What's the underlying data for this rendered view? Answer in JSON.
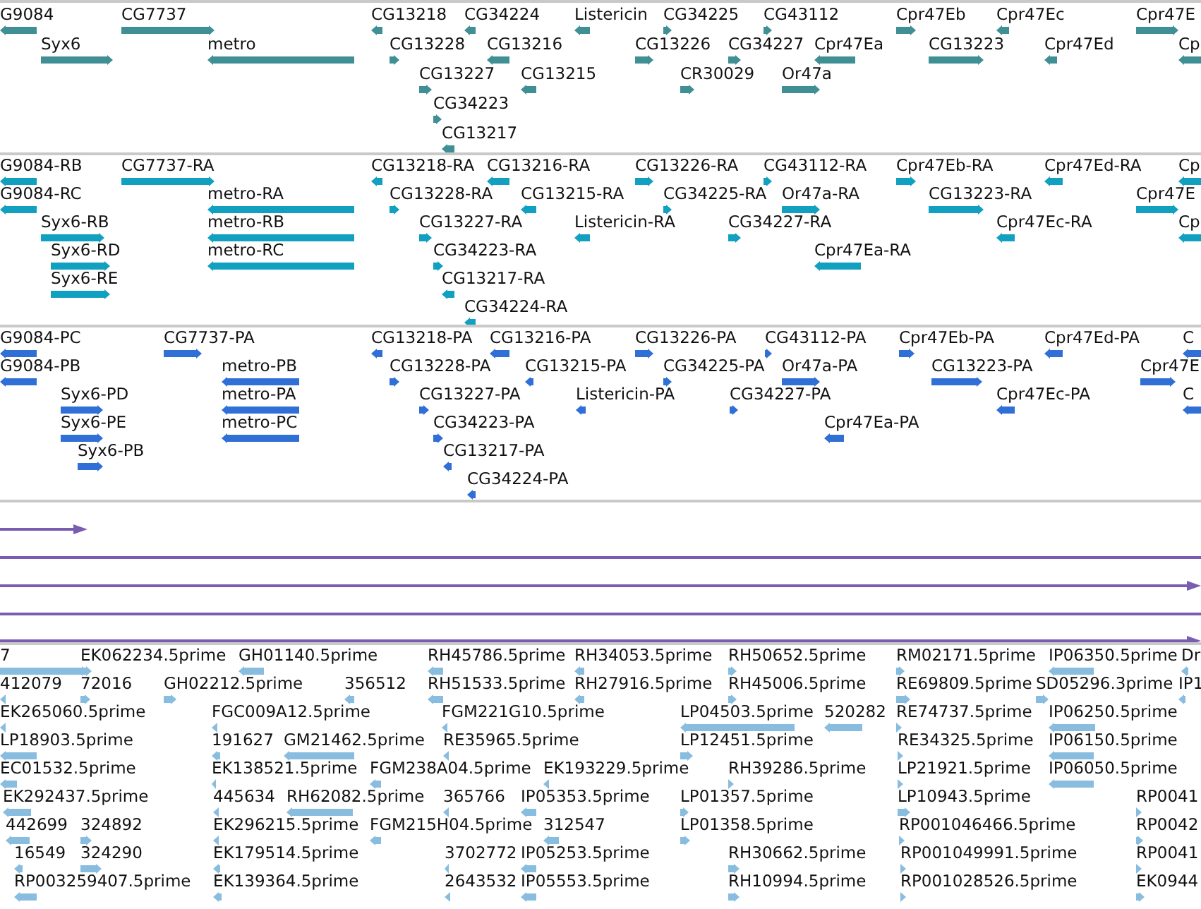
{
  "tracks": [
    {
      "kind": "genes",
      "features": [
        {
          "label": "G9084",
          "reverse": true
        },
        {
          "label": "CG7737",
          "reverse": false
        },
        {
          "label": "CG13218",
          "reverse": true
        },
        {
          "label": "CG34224",
          "reverse": true
        },
        {
          "label": "Listericin",
          "reverse": true
        },
        {
          "label": "CG34225",
          "reverse": false
        },
        {
          "label": "CG43112",
          "reverse": false
        },
        {
          "label": "Cpr47Eb",
          "reverse": false
        },
        {
          "label": "Cpr47Ec",
          "reverse": true
        },
        {
          "label": "Cpr47E",
          "reverse": false
        },
        {
          "label": "Syx6",
          "reverse": false
        },
        {
          "label": "metro",
          "reverse": true
        },
        {
          "label": "CG13228",
          "reverse": false
        },
        {
          "label": "CG13216",
          "reverse": true
        },
        {
          "label": "CG13226",
          "reverse": false
        },
        {
          "label": "CG34227",
          "reverse": false
        },
        {
          "label": "Cpr47Ea",
          "reverse": true
        },
        {
          "label": "CG13223",
          "reverse": false
        },
        {
          "label": "Cpr47Ed",
          "reverse": true
        },
        {
          "label": "Cp",
          "reverse": true
        },
        {
          "label": "CG13227",
          "reverse": false
        },
        {
          "label": "CG13215",
          "reverse": true
        },
        {
          "label": "CR30029",
          "reverse": false
        },
        {
          "label": "Or47a",
          "reverse": false
        },
        {
          "label": "CG34223",
          "reverse": false
        },
        {
          "label": "CG13217",
          "reverse": true
        }
      ]
    },
    {
      "kind": "transcripts",
      "features": [
        {
          "label": "G9084-RB",
          "reverse": true
        },
        {
          "label": "CG7737-RA",
          "reverse": false
        },
        {
          "label": "CG13218-RA",
          "reverse": true
        },
        {
          "label": "CG13216-RA",
          "reverse": true
        },
        {
          "label": "CG13226-RA",
          "reverse": false
        },
        {
          "label": "CG43112-RA",
          "reverse": false
        },
        {
          "label": "Cpr47Eb-RA",
          "reverse": false
        },
        {
          "label": "Cpr47Ed-RA",
          "reverse": true
        },
        {
          "label": "Cp",
          "reverse": true
        },
        {
          "label": "G9084-RC",
          "reverse": true
        },
        {
          "label": "metro-RA",
          "reverse": true
        },
        {
          "label": "CG13228-RA",
          "reverse": false
        },
        {
          "label": "CG13215-RA",
          "reverse": true
        },
        {
          "label": "CG34225-RA",
          "reverse": false
        },
        {
          "label": "Or47a-RA",
          "reverse": false
        },
        {
          "label": "CG13223-RA",
          "reverse": false
        },
        {
          "label": "Cpr47E",
          "reverse": false
        },
        {
          "label": "Syx6-RB",
          "reverse": false
        },
        {
          "label": "metro-RB",
          "reverse": true
        },
        {
          "label": "CG13227-RA",
          "reverse": false
        },
        {
          "label": "Listericin-RA",
          "reverse": true
        },
        {
          "label": "CG34227-RA",
          "reverse": false
        },
        {
          "label": "Cpr47Ec-RA",
          "reverse": true
        },
        {
          "label": "Cp",
          "reverse": true
        },
        {
          "label": "Syx6-RD",
          "reverse": false
        },
        {
          "label": "metro-RC",
          "reverse": true
        },
        {
          "label": "CG34223-RA",
          "reverse": false
        },
        {
          "label": "Cpr47Ea-RA",
          "reverse": true
        },
        {
          "label": "Syx6-RE",
          "reverse": false
        },
        {
          "label": "CG13217-RA",
          "reverse": true
        },
        {
          "label": "CG34224-RA",
          "reverse": true
        }
      ]
    },
    {
      "kind": "proteins",
      "features": [
        {
          "label": "G9084-PC",
          "reverse": true
        },
        {
          "label": "CG7737-PA",
          "reverse": false
        },
        {
          "label": "CG13218-PA",
          "reverse": true
        },
        {
          "label": "CG13216-PA",
          "reverse": true
        },
        {
          "label": "CG13226-PA",
          "reverse": false
        },
        {
          "label": "CG43112-PA",
          "reverse": false
        },
        {
          "label": "Cpr47Eb-PA",
          "reverse": false
        },
        {
          "label": "Cpr47Ed-PA",
          "reverse": true
        },
        {
          "label": "C",
          "reverse": true
        },
        {
          "label": "G9084-PB",
          "reverse": true
        },
        {
          "label": "metro-PB",
          "reverse": true
        },
        {
          "label": "CG13228-PA",
          "reverse": false
        },
        {
          "label": "CG13215-PA",
          "reverse": true
        },
        {
          "label": "CG34225-PA",
          "reverse": false
        },
        {
          "label": "Or47a-PA",
          "reverse": false
        },
        {
          "label": "CG13223-PA",
          "reverse": false
        },
        {
          "label": "Cpr47E",
          "reverse": false
        },
        {
          "label": "Syx6-PD",
          "reverse": false
        },
        {
          "label": "metro-PA",
          "reverse": true
        },
        {
          "label": "CG13227-PA",
          "reverse": false
        },
        {
          "label": "Listericin-PA",
          "reverse": true
        },
        {
          "label": "CG34227-PA",
          "reverse": false
        },
        {
          "label": "Cpr47Ec-PA",
          "reverse": true
        },
        {
          "label": "C",
          "reverse": true
        },
        {
          "label": "Syx6-PE",
          "reverse": false
        },
        {
          "label": "metro-PC",
          "reverse": true
        },
        {
          "label": "CG34223-PA",
          "reverse": false
        },
        {
          "label": "Cpr47Ea-PA",
          "reverse": true
        },
        {
          "label": "Syx6-PB",
          "reverse": false
        },
        {
          "label": "CG13217-PA",
          "reverse": true
        },
        {
          "label": "CG34224-PA",
          "reverse": true
        }
      ]
    },
    {
      "kind": "alignments",
      "alignments": [
        {
          "kind": "line",
          "arrow": true
        },
        {
          "kind": "line"
        },
        {
          "kind": "line",
          "arrow": true
        },
        {
          "kind": "line"
        },
        {
          "kind": "line",
          "arrow": true
        }
      ]
    },
    {
      "kind": "ests",
      "features": [
        {
          "label": "7",
          "reverse": false
        },
        {
          "label": "EK062234.5prime",
          "reverse": false
        },
        {
          "label": "GH01140.5prime",
          "reverse": true
        },
        {
          "label": "RH45786.5prime",
          "reverse": true
        },
        {
          "label": "RH34053.5prime",
          "reverse": true
        },
        {
          "label": "RH50652.5prime",
          "reverse": false
        },
        {
          "label": "RM02171.5prime",
          "reverse": false
        },
        {
          "label": "IP06350.5prime",
          "reverse": true
        },
        {
          "label": "Dr",
          "reverse": true
        },
        {
          "label": "412079",
          "reverse": true
        },
        {
          "label": "72016",
          "reverse": false
        },
        {
          "label": "GH02212.5prime",
          "reverse": false
        },
        {
          "label": "356512",
          "reverse": true
        },
        {
          "label": "RH51533.5prime",
          "reverse": true
        },
        {
          "label": "RH27916.5prime",
          "reverse": true
        },
        {
          "label": "RH45006.5prime",
          "reverse": false
        },
        {
          "label": "RE69809.5prime",
          "reverse": false
        },
        {
          "label": "SD05296.3prime",
          "reverse": false
        },
        {
          "label": "IP1",
          "reverse": true
        },
        {
          "label": "EK265060.5prime",
          "reverse": true
        },
        {
          "label": "FGC009A12.5prime",
          "reverse": true
        },
        {
          "label": "FGM221G10.5prime",
          "reverse": true
        },
        {
          "label": "LP04503.5prime",
          "reverse": true
        },
        {
          "label": "520282",
          "reverse": true
        },
        {
          "label": "RE74737.5prime",
          "reverse": false
        },
        {
          "label": "IP06250.5prime",
          "reverse": true
        },
        {
          "label": "LP18903.5prime",
          "reverse": true
        },
        {
          "label": "191627",
          "reverse": true
        },
        {
          "label": "GM21462.5prime",
          "reverse": true
        },
        {
          "label": "RE35965.5prime",
          "reverse": true
        },
        {
          "label": "LP12451.5prime",
          "reverse": false
        },
        {
          "label": "RE34325.5prime",
          "reverse": false
        },
        {
          "label": "IP06150.5prime",
          "reverse": true
        },
        {
          "label": "EC01532.5prime",
          "reverse": true
        },
        {
          "label": "EK138521.5prime",
          "reverse": true
        },
        {
          "label": "FGM238A04.5prime",
          "reverse": true
        },
        {
          "label": "EK193229.5prime",
          "reverse": true
        },
        {
          "label": "RH39286.5prime",
          "reverse": false
        },
        {
          "label": "LP21921.5prime",
          "reverse": false
        },
        {
          "label": "IP06050.5prime",
          "reverse": true
        },
        {
          "label": "EK292437.5prime",
          "reverse": true
        },
        {
          "label": "445634",
          "reverse": true
        },
        {
          "label": "RH62082.5prime",
          "reverse": true
        },
        {
          "label": "365766",
          "reverse": true
        },
        {
          "label": "IP05353.5prime",
          "reverse": true
        },
        {
          "label": "LP01357.5prime",
          "reverse": false
        },
        {
          "label": "LP10943.5prime",
          "reverse": false
        },
        {
          "label": "RP0041",
          "reverse": false
        },
        {
          "label": "442699",
          "reverse": true
        },
        {
          "label": "324892",
          "reverse": false
        },
        {
          "label": "EK296215.5prime",
          "reverse": true
        },
        {
          "label": "FGM215H04.5prime",
          "reverse": true
        },
        {
          "label": "312547",
          "reverse": true
        },
        {
          "label": "LP01358.5prime",
          "reverse": false
        },
        {
          "label": "RP001046466.5prime",
          "reverse": false
        },
        {
          "label": "RP0042",
          "reverse": false
        },
        {
          "label": "16549",
          "reverse": true
        },
        {
          "label": "324290",
          "reverse": false
        },
        {
          "label": "EK179514.5prime",
          "reverse": true
        },
        {
          "label": "3702772",
          "reverse": true
        },
        {
          "label": "IP05253.5prime",
          "reverse": true
        },
        {
          "label": "RH30662.5prime",
          "reverse": false
        },
        {
          "label": "RP001049991.5prime",
          "reverse": false
        },
        {
          "label": "RP0041",
          "reverse": false
        },
        {
          "label": "RP003259407.5prime",
          "reverse": true
        },
        {
          "label": "EK139364.5prime",
          "reverse": true
        },
        {
          "label": "2643532",
          "reverse": true
        },
        {
          "label": "IP05553.5prime",
          "reverse": true
        },
        {
          "label": "RH10994.5prime",
          "reverse": false
        },
        {
          "label": "RP001028526.5prime",
          "reverse": false
        },
        {
          "label": "EK0944",
          "reverse": false
        }
      ]
    }
  ]
}
